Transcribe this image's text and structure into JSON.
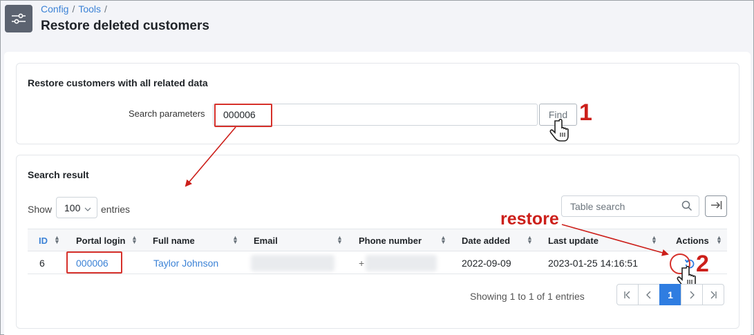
{
  "breadcrumb": {
    "items": [
      "Config",
      "Tools"
    ],
    "separator": "/"
  },
  "page": {
    "title": "Restore deleted customers"
  },
  "restore_card": {
    "title": "Restore customers with all related data",
    "search_label": "Search parameters",
    "search_value": "000006",
    "find_label": "Find"
  },
  "results_card": {
    "title": "Search result",
    "show_label": "Show",
    "entries_value": "100",
    "entries_label": "entries",
    "table_search_placeholder": "Table search",
    "columns": [
      "ID",
      "Portal login",
      "Full name",
      "Email",
      "Phone number",
      "Date added",
      "Last update",
      "Actions"
    ],
    "rows": [
      {
        "id": "6",
        "portal_login": "000006",
        "full_name": "Taylor Johnson",
        "email": "",
        "phone_prefix": "+",
        "date_added": "2022-09-09",
        "last_update": "2023-01-25 14:16:51",
        "action_icon": "restore-icon"
      }
    ],
    "showing_text": "Showing 1 to 1 of 1 entries",
    "pagination": {
      "current_page": "1",
      "first": "|<",
      "prev": "<",
      "next": ">",
      "last": ">|"
    }
  },
  "annotations": {
    "step1": "1",
    "step2": "2",
    "restore_label": "restore",
    "color": "#cc1f1a"
  },
  "colors": {
    "accent": "#2f7de1",
    "link": "#3b82d6",
    "highlight": "#d6302a"
  }
}
